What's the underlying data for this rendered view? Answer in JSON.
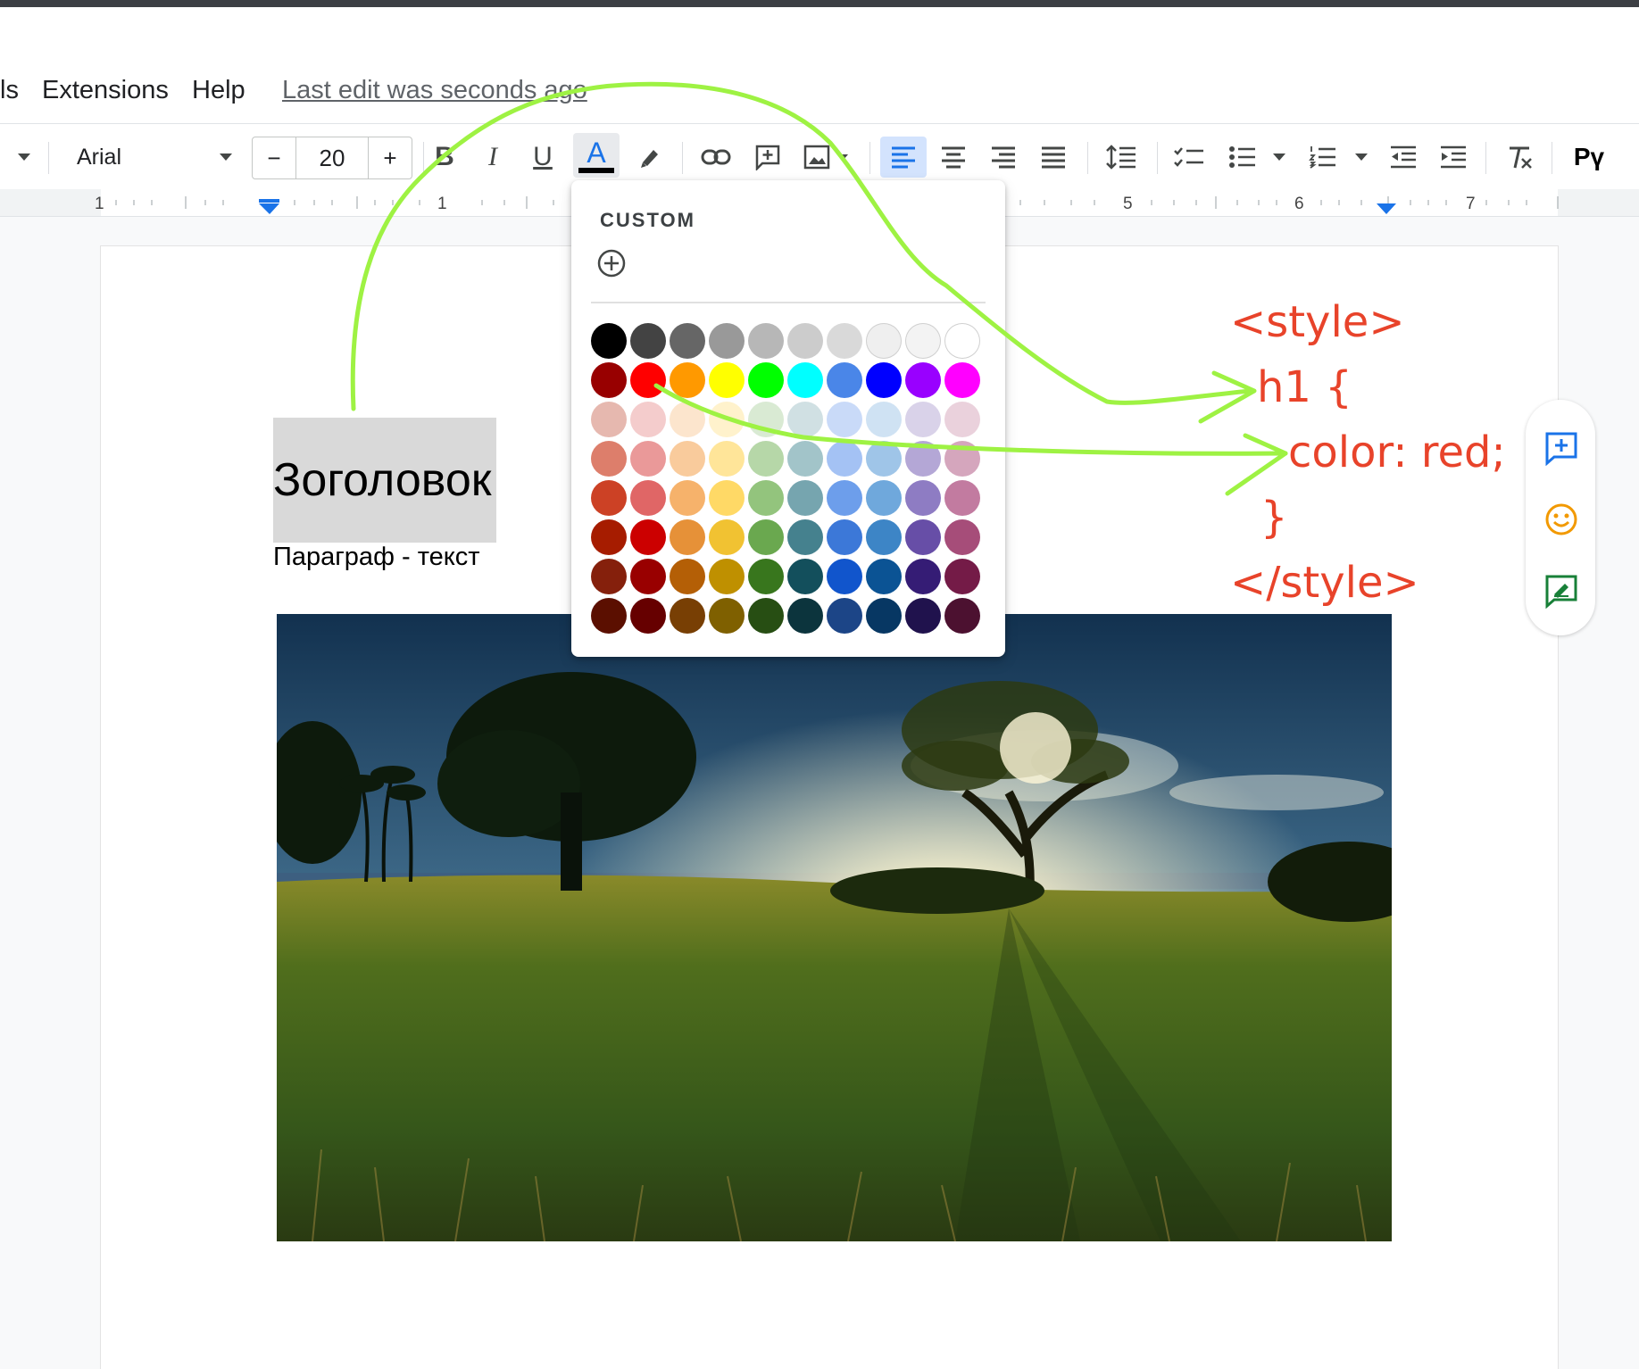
{
  "menu": {
    "items": [
      "ls",
      "Extensions",
      "Help"
    ],
    "last_edit": "Last edit was seconds ago"
  },
  "toolbar": {
    "font": "Arial",
    "font_size": "20",
    "minus": "−",
    "plus": "+",
    "bold": "B",
    "italic": "I",
    "underline": "U",
    "text_color": "A",
    "input_tools": "Рү",
    "text_color_value": "#000000"
  },
  "ruler": {
    "labels": [
      "1",
      "1",
      "5",
      "6",
      "7"
    ]
  },
  "palette": {
    "custom_label": "CUSTOM",
    "rows": [
      [
        "#000000",
        "#434343",
        "#666666",
        "#999999",
        "#b7b7b7",
        "#cccccc",
        "#d9d9d9",
        "#efefef",
        "#f3f3f3",
        "#ffffff"
      ],
      [
        "#980000",
        "#ff0000",
        "#ff9900",
        "#ffff00",
        "#00ff00",
        "#00ffff",
        "#4a86e8",
        "#0000ff",
        "#9900ff",
        "#ff00ff"
      ],
      [
        "#e6b8af",
        "#f4cccc",
        "#fce5cd",
        "#fff2cc",
        "#d9ead3",
        "#d0e0e3",
        "#c9daf8",
        "#cfe2f3",
        "#d9d2e9",
        "#ead1dc"
      ],
      [
        "#dd7e6b",
        "#ea9999",
        "#f9cb9c",
        "#ffe599",
        "#b6d7a8",
        "#a2c4c9",
        "#a4c2f4",
        "#9fc5e8",
        "#b4a7d6",
        "#d5a6bd"
      ],
      [
        "#cc4125",
        "#e06666",
        "#f6b26b",
        "#ffd966",
        "#93c47d",
        "#76a5af",
        "#6d9eeb",
        "#6fa8dc",
        "#8e7cc3",
        "#c27ba0"
      ],
      [
        "#a61c00",
        "#cc0000",
        "#e69138",
        "#f1c232",
        "#6aa84f",
        "#45818e",
        "#3c78d8",
        "#3d85c6",
        "#674ea7",
        "#a64d79"
      ],
      [
        "#85200c",
        "#990000",
        "#b45f06",
        "#bf9000",
        "#38761d",
        "#134f5c",
        "#1155cc",
        "#0b5394",
        "#351c75",
        "#741b47"
      ],
      [
        "#5b0f00",
        "#660000",
        "#783f04",
        "#7f6000",
        "#274e13",
        "#0c343d",
        "#1c4587",
        "#073763",
        "#20124d",
        "#4c1130"
      ]
    ]
  },
  "document": {
    "heading": "Зоголовок",
    "paragraph": "Параграф - текст"
  },
  "annotation": {
    "color": "#e8432a",
    "line_color": "#9ef243",
    "lines": [
      "<style>",
      "h1 {",
      "color: red;",
      "}",
      "</style>"
    ]
  },
  "side_panel": {
    "icons": [
      "add-comment-icon",
      "emoji-reaction-icon",
      "suggest-edit-icon"
    ]
  }
}
